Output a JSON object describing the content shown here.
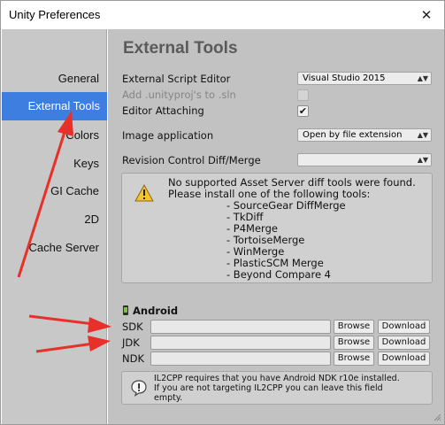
{
  "window": {
    "title": "Unity Preferences",
    "close_glyph": "✕"
  },
  "sidebar": {
    "items": [
      {
        "label": "General",
        "active": false
      },
      {
        "label": "External Tools",
        "active": true
      },
      {
        "label": "Colors",
        "active": false
      },
      {
        "label": "Keys",
        "active": false
      },
      {
        "label": "GI Cache",
        "active": false
      },
      {
        "label": "2D",
        "active": false
      },
      {
        "label": "Cache Server",
        "active": false
      }
    ]
  },
  "main": {
    "title": "External Tools",
    "external_script_editor": {
      "label": "External Script Editor",
      "value": "Visual Studio 2015"
    },
    "add_unityproj": {
      "label": "Add .unityproj's to .sln",
      "checked": false,
      "disabled": true
    },
    "editor_attaching": {
      "label": "Editor Attaching",
      "checked": true,
      "check_glyph": "✔"
    },
    "image_application": {
      "label": "Image application",
      "value": "Open by file extension"
    },
    "revision_control": {
      "label": "Revision Control Diff/Merge",
      "value": ""
    },
    "dropdown_arrow": "▲▼",
    "diff_help": {
      "icon": "warning-icon",
      "line1": "No supported Asset Server diff tools were found.",
      "line2": "Please install one of the following tools:",
      "tools": [
        "- SourceGear DiffMerge",
        "- TkDiff",
        "- P4Merge",
        "- TortoiseMerge",
        "- WinMerge",
        "- PlasticSCM Merge",
        "- Beyond Compare 4"
      ]
    },
    "android": {
      "header": "Android",
      "icon": "android-icon",
      "sdk": {
        "label": "SDK",
        "value": ""
      },
      "jdk": {
        "label": "JDK",
        "value": ""
      },
      "ndk": {
        "label": "NDK",
        "value": ""
      },
      "browse_label": "Browse",
      "download_label": "Download"
    },
    "il2cpp_info": {
      "icon": "info-icon",
      "line1": "IL2CPP requires that you have Android NDK r10e installed.",
      "line2": "If you are not targeting IL2CPP you can leave this field",
      "line3": "empty."
    }
  },
  "annotations": {
    "arrow_color": "#e8302a",
    "arrows": [
      "arrow-to-external-tools",
      "arrow-to-sdk",
      "arrow-to-jdk"
    ]
  },
  "colors": {
    "sidebar_active": "#3d7ee0",
    "sidebar_bg": "#c8c8c8",
    "panel_bg": "#c2c2c2"
  }
}
